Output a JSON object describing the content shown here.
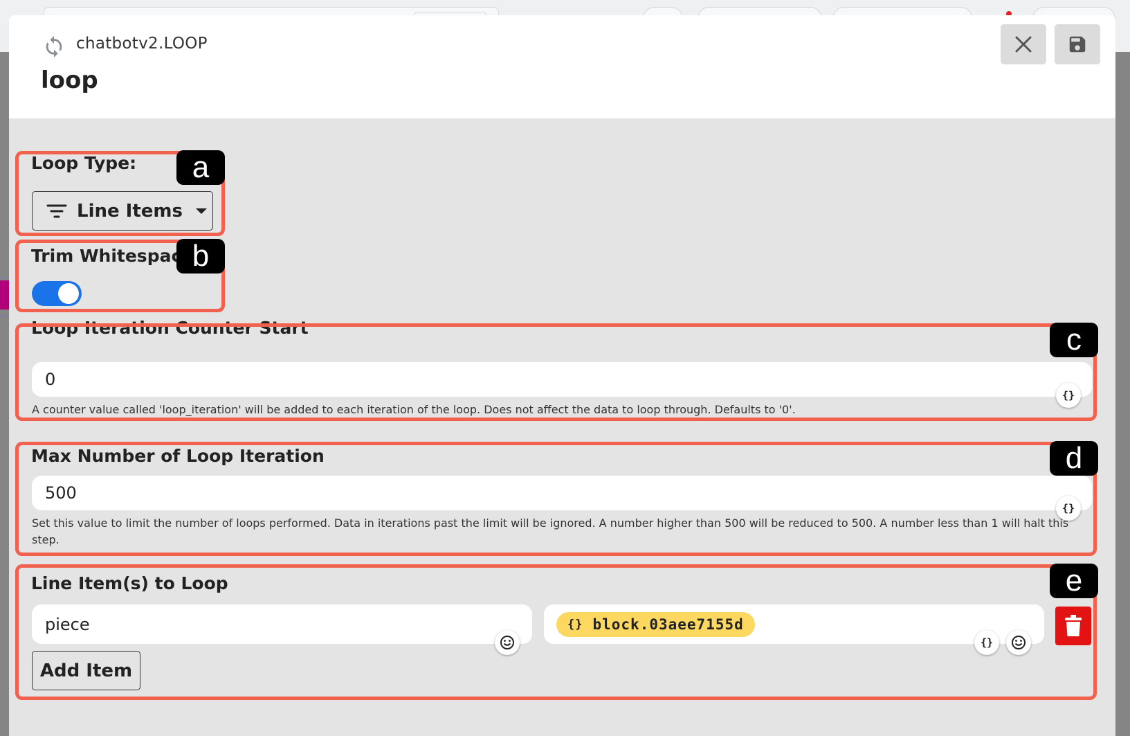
{
  "header": {
    "breadcrumb": "chatbotv2.LOOP",
    "title": "loop"
  },
  "loop_type": {
    "label": "Loop Type:",
    "selected": "Line Items"
  },
  "trim_whitespace": {
    "label": "Trim Whitespace",
    "enabled": true
  },
  "counter_start": {
    "label": "Loop Iteration Counter Start",
    "value": "0",
    "help": "A counter value called 'loop_iteration' will be added to each iteration of the loop. Does not affect the data to loop through. Defaults to '0'."
  },
  "max_iterations": {
    "label": "Max Number of Loop Iteration",
    "value": "500",
    "help": "Set this value to limit the number of loops performed. Data in iterations past the limit will be ignored. A number higher than 500 will be reduced to 500. A number less than 1 will halt this step."
  },
  "line_items": {
    "label": "Line Item(s) to Loop",
    "items": [
      {
        "key": "piece",
        "value_chip_icon": "{}",
        "value_chip": "block.03aee7155d"
      }
    ],
    "add_label": "Add Item"
  },
  "variable_icon_glyph": "{}",
  "annotations": [
    "a",
    "b",
    "c",
    "d",
    "e"
  ],
  "colors": {
    "annotation_border": "#f2604e",
    "toggle_on": "#1a73e8",
    "chip": "#fcd860",
    "delete": "#e31313"
  }
}
